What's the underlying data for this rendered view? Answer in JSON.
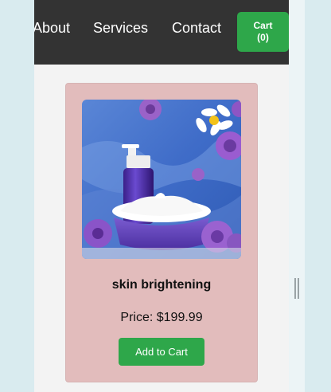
{
  "nav": {
    "links": [
      "About",
      "Services",
      "Contact"
    ],
    "cart_label": "Cart",
    "cart_count": "(0)"
  },
  "product": {
    "name": "skin brightening",
    "price": "Price: $199.99",
    "add_to_cart": "Add to Cart",
    "image_icon": "cosmetic-product-photo"
  },
  "colors": {
    "nav_bg": "#333333",
    "accent_green": "#2ea74a",
    "card_bg": "#e2bcbc",
    "page_bg": "#f3f3f3",
    "outer_bg": "#d9ebef"
  }
}
